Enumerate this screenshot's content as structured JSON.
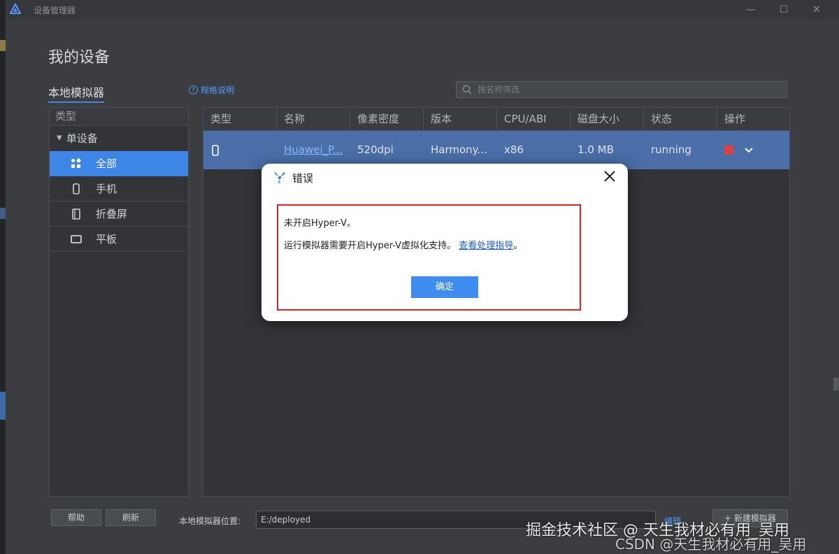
{
  "window": {
    "title": "设备管理器",
    "minimize": "—",
    "maximize": "☐",
    "close": "✕"
  },
  "page": {
    "title": "我的设备",
    "section": "本地模拟器",
    "spec_link": "规格说明",
    "search_placeholder": "按名称筛选"
  },
  "sidebar": {
    "header": "类型",
    "group": "单设备",
    "items": [
      {
        "label": "全部",
        "icon": "grid-icon",
        "active": true
      },
      {
        "label": "手机",
        "icon": "phone-icon"
      },
      {
        "label": "折叠屏",
        "icon": "foldable-icon"
      },
      {
        "label": "平板",
        "icon": "tablet-icon"
      }
    ]
  },
  "table": {
    "columns": [
      "类型",
      "名称",
      "像素密度",
      "版本",
      "CPU/ABI",
      "磁盘大小",
      "状态",
      "操作"
    ],
    "rows": [
      {
        "name": "Huawei_P...",
        "density": "520dpi",
        "version": "Harmony...",
        "cpu": "x86",
        "disk": "1.0 MB",
        "status": "running"
      }
    ]
  },
  "bottom": {
    "help": "帮助",
    "refresh": "刷新",
    "location_label": "本地模拟器位置:",
    "location_value": "E:/deployed",
    "edit": "编辑",
    "new_emulator": "新建模拟器"
  },
  "dialog": {
    "title": "错误",
    "line1": "未开启Hyper-V。",
    "line2_text": "运行模拟器需要开启Hyper-V虚拟化支持。",
    "line2_link": "查看处理指导",
    "line2_end": "。",
    "ok": "确定"
  },
  "watermark": {
    "line1": "掘金技术社区 @ 天生我材必有用_吴用",
    "line2": "CSDN @天生我材必有用_吴用"
  },
  "colors": {
    "accent": "#3d86e8",
    "row_selected": "#4a6ea7",
    "stop": "#e0403e",
    "dialog_border": "#e02020"
  }
}
